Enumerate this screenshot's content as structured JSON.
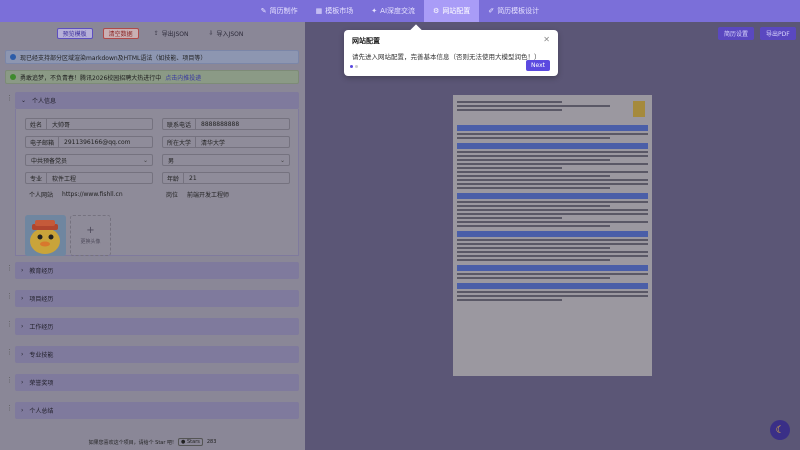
{
  "nav": {
    "tabs": [
      {
        "label": "简历制作",
        "icon": "edit-icon"
      },
      {
        "label": "模板市场",
        "icon": "template-icon"
      },
      {
        "label": "AI深度交流",
        "icon": "ai-icon"
      },
      {
        "label": "网站配置",
        "icon": "settings-icon"
      },
      {
        "label": "简历模板设计",
        "icon": "design-icon"
      }
    ]
  },
  "toolbar": {
    "preview_template": "预览模板",
    "clear_data": "清空数据",
    "export_json": "导出JSON",
    "import_json": "导入JSON"
  },
  "notices": {
    "info": "现已经支持部分区域渲染markdown及HTML语法（如技能、项目等）",
    "success_text": "勇敢追梦，不负青春！腾讯2026校园招聘大热进行中",
    "success_link": "点击内推投递"
  },
  "sections": {
    "personal": "个人信息",
    "education": "教育经历",
    "project": "项目经历",
    "work": "工作经历",
    "skills": "专业技能",
    "awards": "荣誉奖项",
    "summary": "个人总结"
  },
  "personal": {
    "name_label": "姓名",
    "name_value": "大帅哥",
    "phone_label": "联系电话",
    "phone_value": "8888888888",
    "email_label": "电子邮箱",
    "email_value": "2911396166@qq.com",
    "university_label": "所在大学",
    "university_value": "清华大学",
    "party_value": "中共预备党员",
    "gender_value": "男",
    "major_label": "专业",
    "major_value": "软件工程",
    "age_label": "年龄",
    "age_value": "21",
    "website_label": "个人网站",
    "website_value": "https://www.fishll.cn",
    "position_label": "岗位",
    "position_value": "前端开发工程师",
    "upload_label": "更换头像"
  },
  "footer": {
    "text": "如果您喜欢这个项目，请给个 Star 吧!",
    "stars_label": "Stars",
    "stars_count": "283"
  },
  "right": {
    "site_settings": "简历设置",
    "export_pdf": "导出PDF"
  },
  "popover": {
    "title": "网站配置",
    "description": "请先进入网站配置，完善基本信息（否则无法使用大模型润色！）",
    "next": "Next"
  },
  "colors": {
    "accent": "#7b6fd9",
    "primary_button": "#5b4ae0"
  }
}
